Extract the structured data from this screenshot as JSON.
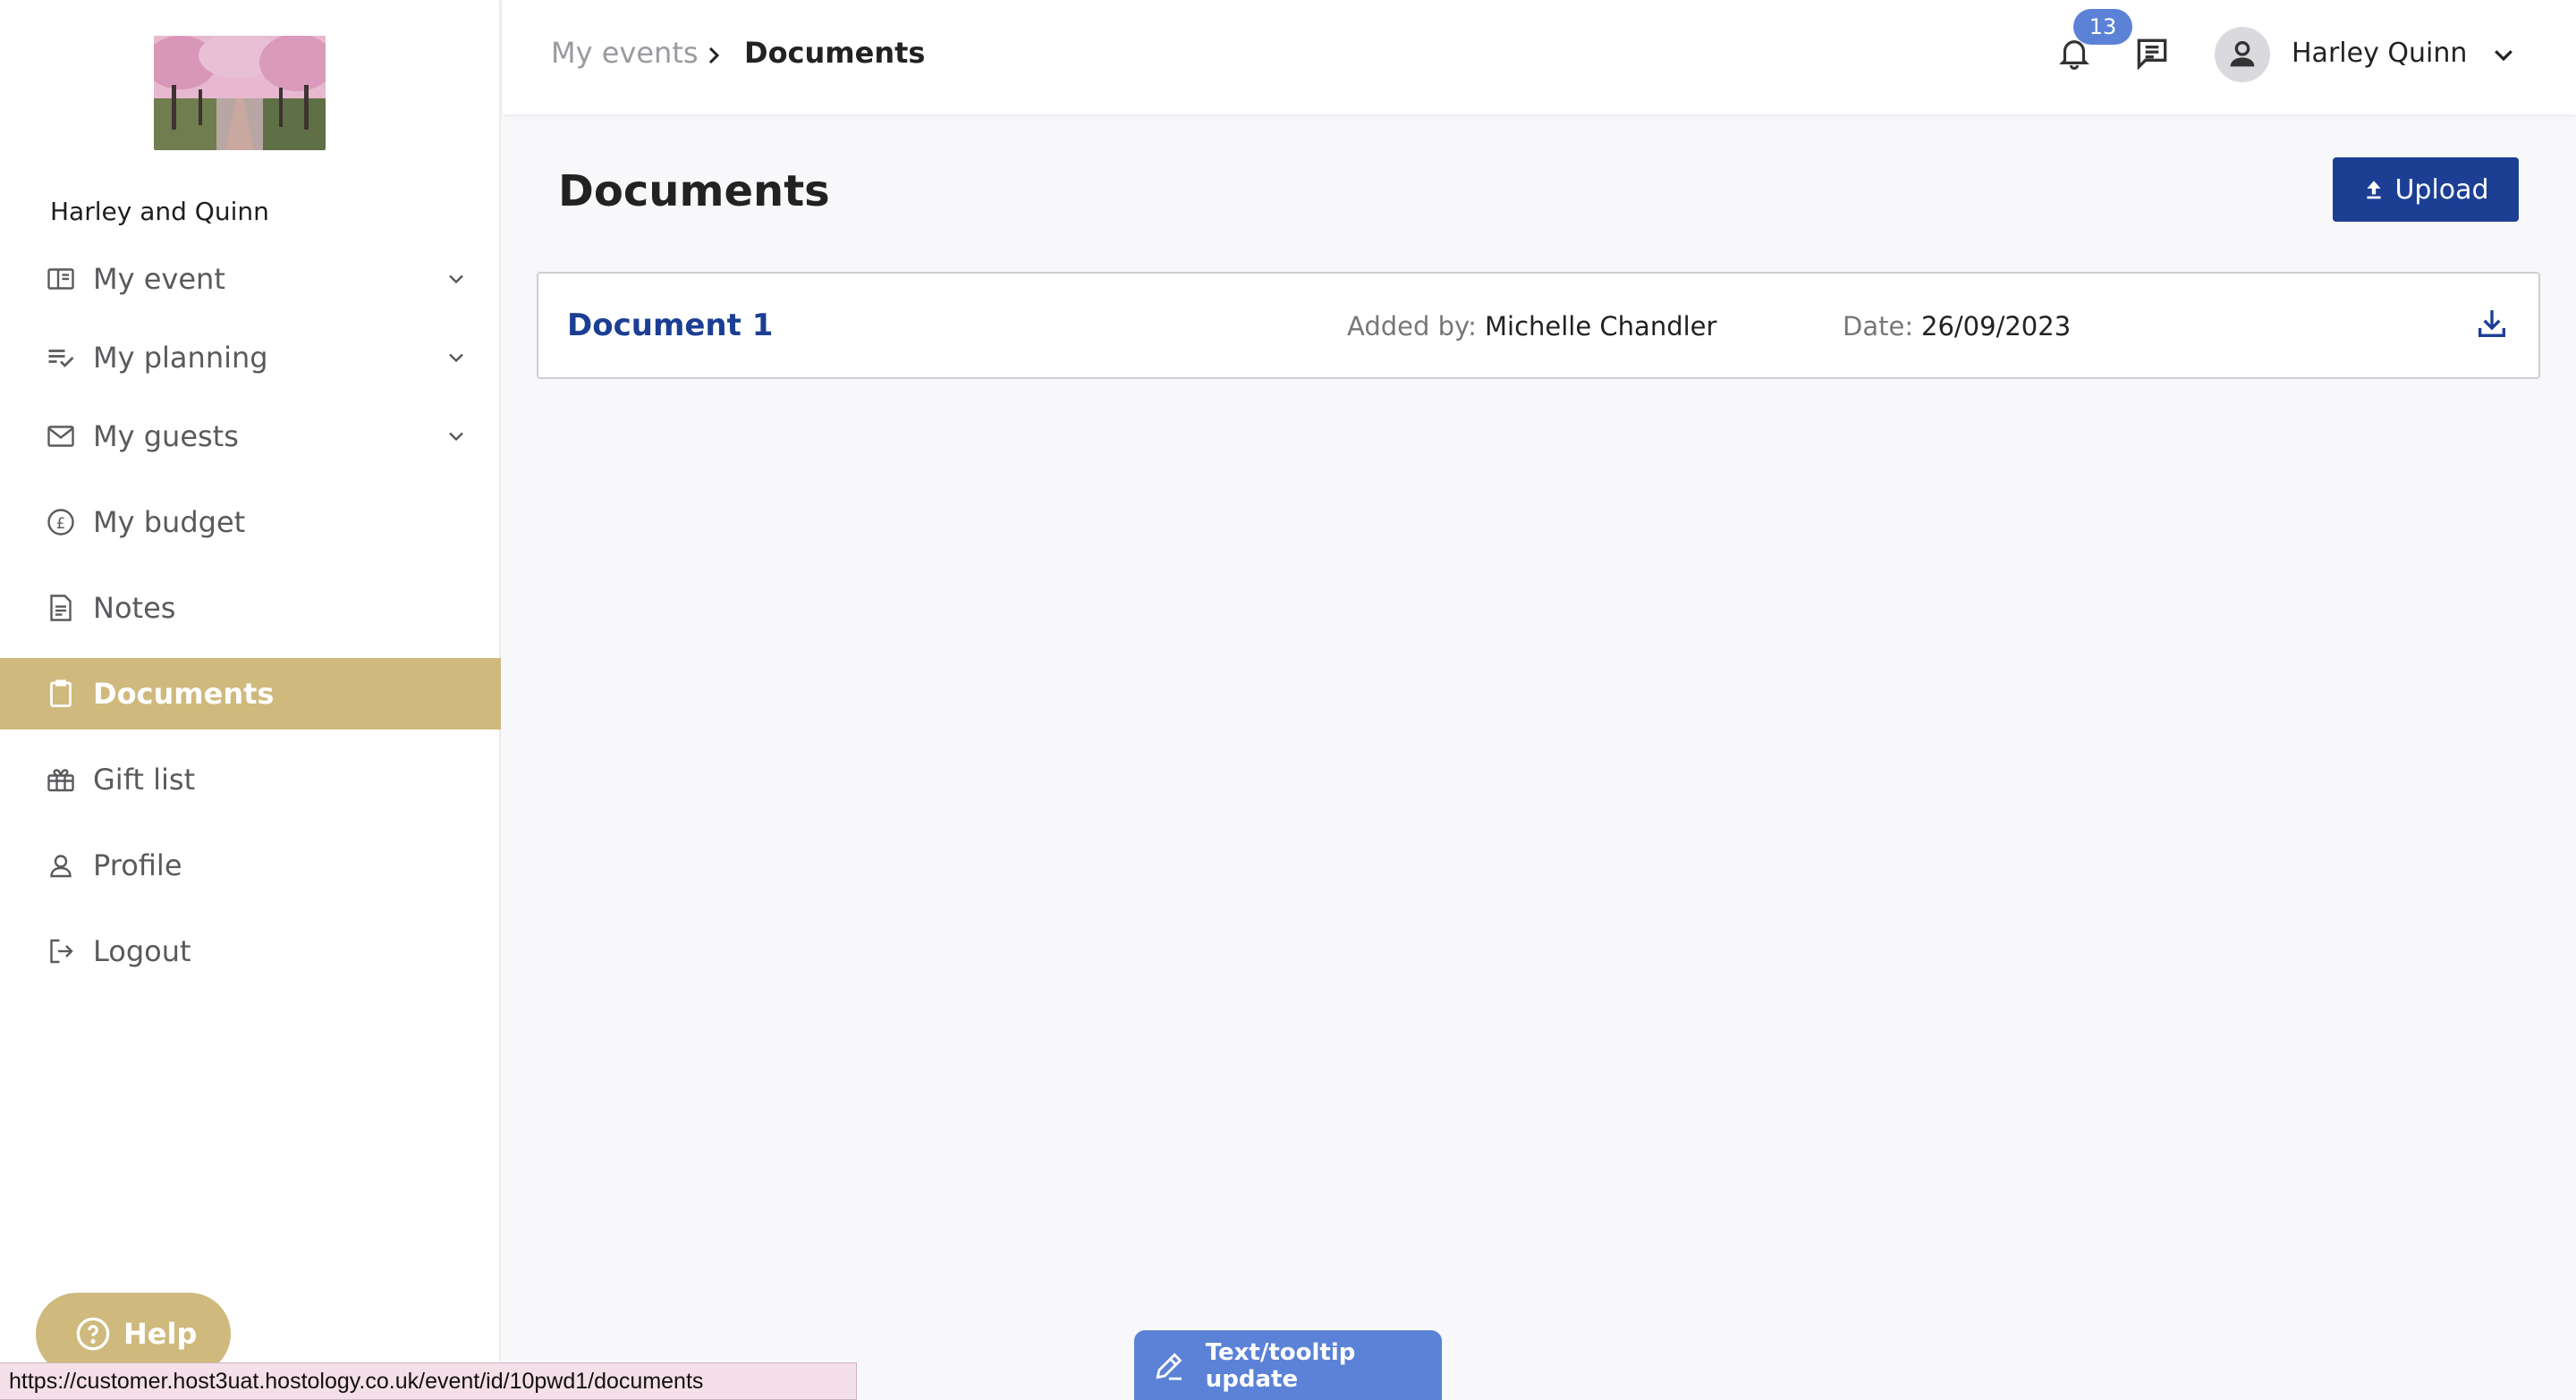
{
  "event": {
    "name": "Harley and Quinn",
    "image_desc": "cherry-blossom-avenue"
  },
  "sidebar": {
    "items": [
      {
        "label": "My event",
        "icon": "book-open-icon",
        "expandable": true
      },
      {
        "label": "My planning",
        "icon": "checklist-icon",
        "expandable": true
      },
      {
        "label": "My guests",
        "icon": "envelope-icon",
        "expandable": true
      },
      {
        "label": "My budget",
        "icon": "pound-coin-icon",
        "expandable": false
      },
      {
        "label": "Notes",
        "icon": "note-icon",
        "expandable": false
      },
      {
        "label": "Documents",
        "icon": "clipboard-icon",
        "expandable": false,
        "active": true
      },
      {
        "label": "Gift list",
        "icon": "gift-icon",
        "expandable": false
      },
      {
        "label": "Profile",
        "icon": "person-icon",
        "expandable": false
      },
      {
        "label": "Logout",
        "icon": "logout-icon",
        "expandable": false
      }
    ],
    "help_label": "Help"
  },
  "status_bar": {
    "url": "https://customer.host3uat.hostology.co.uk/event/id/10pwd1/documents"
  },
  "header": {
    "breadcrumb_parent": "My events",
    "breadcrumb_current": "Documents",
    "notification_count": "13",
    "user_name": "Harley Quinn"
  },
  "main": {
    "title": "Documents",
    "upload_label": "Upload",
    "documents": [
      {
        "name": "Document 1",
        "added_by_label": "Added by:",
        "added_by": "Michelle Chandler",
        "date_label": "Date:",
        "date": "26/09/2023"
      }
    ]
  },
  "floating": {
    "tooltip_update_label": "Text/tooltip update"
  },
  "colors": {
    "accent_gold": "#cfb97d",
    "primary_blue": "#1c3f94",
    "badge_blue": "#5b82d6"
  }
}
